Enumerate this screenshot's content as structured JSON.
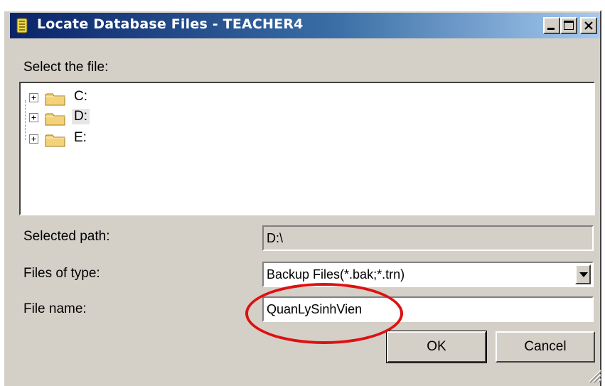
{
  "window": {
    "title": "Locate Database Files - TEACHER4",
    "icon": "database-app-icon",
    "caption_buttons": [
      "minimize-icon",
      "maximize-icon",
      "close-icon"
    ]
  },
  "labels": {
    "select_file": "Select the file:",
    "selected_path": "Selected path:",
    "files_of_type": "Files of type:",
    "file_name": "File name:"
  },
  "tree": {
    "items": [
      {
        "label": "C:",
        "icon": "folder-icon",
        "selected": false
      },
      {
        "label": "D:",
        "icon": "folder-icon",
        "selected": true
      },
      {
        "label": "E:",
        "icon": "folder-icon",
        "selected": false
      }
    ]
  },
  "fields": {
    "selected_path": "D:\\",
    "files_of_type": "Backup Files(*.bak;*.trn)",
    "file_name": "QuanLySinhVien"
  },
  "buttons": {
    "ok": "OK",
    "cancel": "Cancel"
  },
  "colors": {
    "title_start": "#0a246a",
    "title_end": "#a6caf0",
    "face": "#d4d0c8",
    "annotation": "#dd1111"
  }
}
